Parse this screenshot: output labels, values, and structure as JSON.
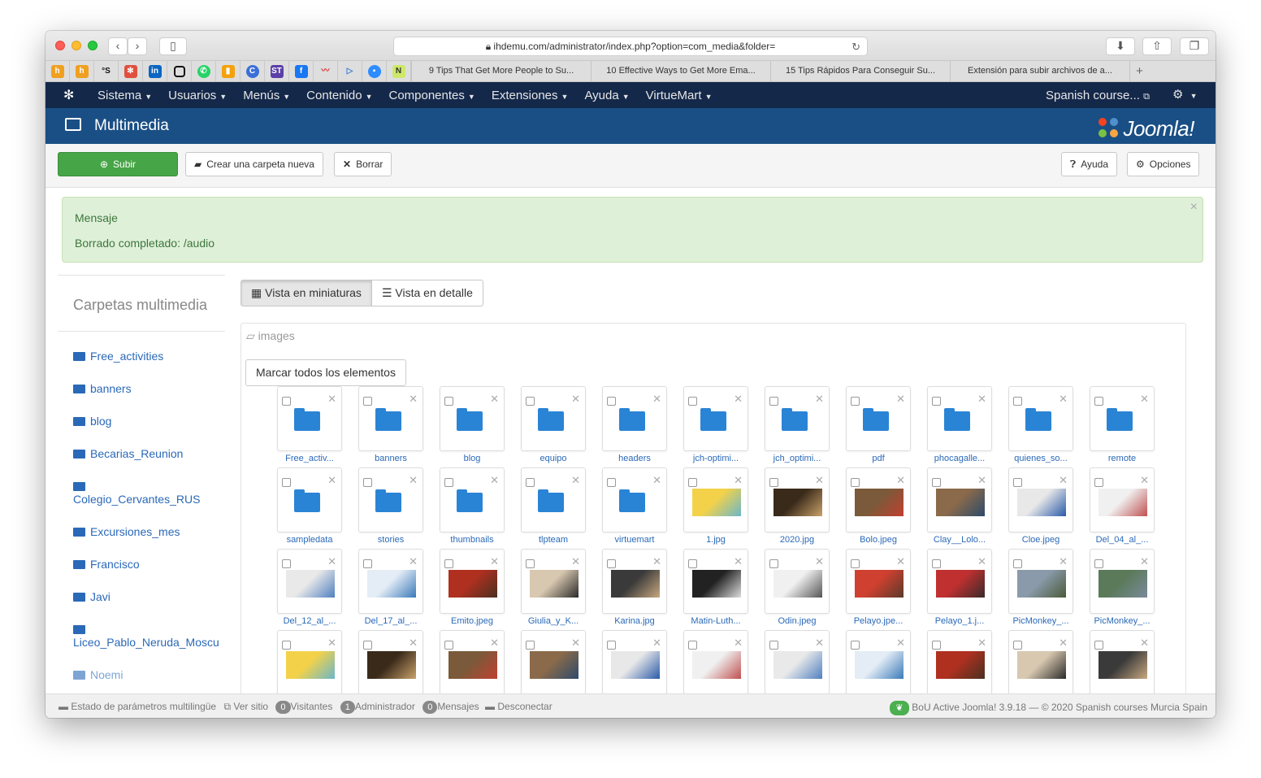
{
  "browser": {
    "url": "ihdemu.com/administrator/index.php?option=com_media&folder=",
    "tabs": [
      "9 Tips That Get More People to Su...",
      "10 Effective Ways to Get More Ema...",
      "15 Tips Rápidos Para Conseguir Su...",
      "Extensión para subir archivos de a..."
    ]
  },
  "nav": {
    "items": [
      "Sistema",
      "Usuarios",
      "Menús",
      "Contenido",
      "Componentes",
      "Extensiones",
      "Ayuda",
      "VirtueMart"
    ],
    "site": "Spanish course..."
  },
  "header": {
    "title": "Multimedia",
    "brand": "Joomla!"
  },
  "toolbar": {
    "upload": "Subir",
    "new_folder": "Crear una carpeta nueva",
    "delete": "Borrar",
    "help": "Ayuda",
    "options": "Opciones"
  },
  "message": {
    "heading": "Mensaje",
    "body": "Borrado completado: /audio"
  },
  "sidebar": {
    "title": "Carpetas multimedia",
    "folders": [
      "Free_activities",
      "banners",
      "blog",
      "Becarias_Reunion",
      "Colegio_Cervantes_RUS",
      "Excursiones_mes",
      "Francisco",
      "Javi",
      "Liceo_Pablo_Neruda_Moscu",
      "Noemi"
    ]
  },
  "view": {
    "thumbs": "Vista en miniaturas",
    "detail": "Vista en detalle"
  },
  "panel": {
    "crumb": "images",
    "check_all": "Marcar todos los elementos",
    "items": [
      "Free_activ...",
      "banners",
      "blog",
      "equipo",
      "headers",
      "jch-optimi...",
      "jch_optimi...",
      "pdf",
      "phocagalle...",
      "quienes_so...",
      "remote",
      "sampledata",
      "stories",
      "thumbnails",
      "tlpteam",
      "virtuemart",
      "1.jpg",
      "2020.jpg",
      "Bolo.jpeg",
      "Clay__Lolo...",
      "Cloe.jpeg",
      "Del_04_al_...",
      "Del_12_al_...",
      "Del_17_al_...",
      "Emito.jpeg",
      "Giulia_y_K...",
      "Karina.jpg",
      "Matin-Luth...",
      "Odin.jpeg",
      "Pelayo.jpe...",
      "Pelayo_1.j...",
      "PicMonkey_...",
      "PicMonkey_..."
    ]
  },
  "status": {
    "lang": "Estado de parámetros multilingüe",
    "site": "Ver sitio",
    "visitors_count": "0",
    "visitors": "Visitantes",
    "admins_count": "1",
    "admins": "Administrador",
    "messages_count": "0",
    "messages": "Mensajes",
    "logout": "Desconectar",
    "version": "BoU Active Joomla! 3.9.18",
    "copyright": "© 2020 Spanish courses Murcia Spain"
  }
}
